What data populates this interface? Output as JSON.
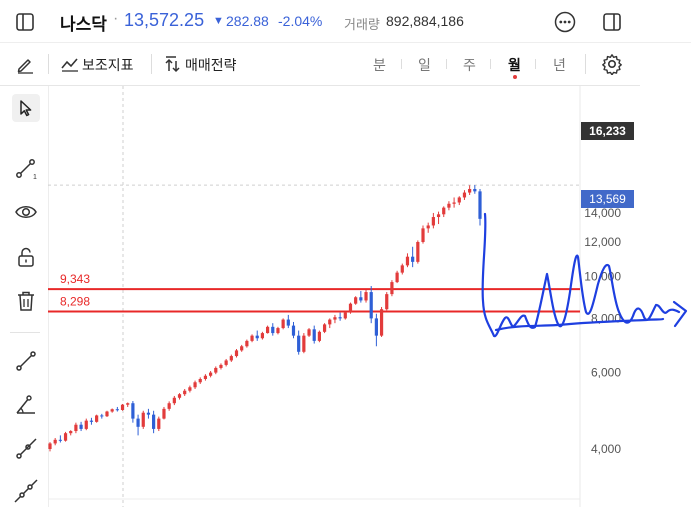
{
  "header": {
    "symbol": "나스닥",
    "dot": "·",
    "price": "13,572.25",
    "change_arrow": "▼",
    "change": "282.88",
    "change_pct": "-2.04%",
    "volume_label": "거래량",
    "volume": "892,884,186",
    "icons": [
      "sidebar-toggle-icon",
      "more-icon",
      "panel-icon"
    ]
  },
  "toolbar": {
    "indicators_label": "보조지표",
    "strategy_label": "매매전략",
    "periods": [
      "분",
      "일",
      "주",
      "월",
      "년"
    ],
    "active_period": "월",
    "icons": [
      "pen-icon",
      "indicator-icon",
      "strategy-icon",
      "settings-icon"
    ]
  },
  "left_tools": [
    "cursor-icon",
    "trendline-icon",
    "eye-icon",
    "unlock-icon",
    "trash-icon",
    "line-icon",
    "angle-icon",
    "ray-icon",
    "extended-line-icon"
  ],
  "colors": {
    "up": "#e23b3b",
    "down": "#2e5fd6",
    "accent": "#3a62d8",
    "hline": "#e82828",
    "annotation": "#1e3fe0",
    "price_tag": "#4169c9",
    "high_tag": "#333333"
  },
  "chart_data": {
    "type": "candlestick",
    "y_scale": "log",
    "ylim": [
      3000,
      22000
    ],
    "y_ticks": [
      "4,000",
      "6,000",
      "8,000",
      "10,000",
      "12,000",
      "14,000"
    ],
    "tags": {
      "high": "16,233",
      "current": "13,569"
    },
    "hlines": [
      {
        "label": "9,343",
        "value": 9343
      },
      {
        "label": "8,298",
        "value": 8298
      }
    ],
    "ohlc": [
      [
        4000,
        4150,
        3950,
        4120
      ],
      [
        4120,
        4240,
        4080,
        4200
      ],
      [
        4200,
        4300,
        4140,
        4180
      ],
      [
        4180,
        4380,
        4160,
        4350
      ],
      [
        4350,
        4420,
        4300,
        4400
      ],
      [
        4400,
        4600,
        4350,
        4550
      ],
      [
        4550,
        4620,
        4400,
        4450
      ],
      [
        4450,
        4700,
        4420,
        4650
      ],
      [
        4650,
        4720,
        4550,
        4620
      ],
      [
        4620,
        4800,
        4600,
        4780
      ],
      [
        4780,
        4820,
        4700,
        4760
      ],
      [
        4760,
        4900,
        4740,
        4880
      ],
      [
        4880,
        4960,
        4850,
        4940
      ],
      [
        4940,
        5000,
        4880,
        4920
      ],
      [
        4920,
        5080,
        4900,
        5060
      ],
      [
        5060,
        5120,
        5000,
        5100
      ],
      [
        5100,
        5160,
        4600,
        4700
      ],
      [
        4700,
        4800,
        4300,
        4500
      ],
      [
        4500,
        4900,
        4450,
        4850
      ],
      [
        4850,
        4950,
        4700,
        4800
      ],
      [
        4800,
        4900,
        4350,
        4450
      ],
      [
        4450,
        4750,
        4400,
        4700
      ],
      [
        4700,
        5000,
        4680,
        4950
      ],
      [
        4950,
        5150,
        4900,
        5100
      ],
      [
        5100,
        5300,
        5050,
        5250
      ],
      [
        5250,
        5380,
        5200,
        5350
      ],
      [
        5350,
        5500,
        5300,
        5450
      ],
      [
        5450,
        5600,
        5400,
        5550
      ],
      [
        5550,
        5750,
        5500,
        5700
      ],
      [
        5700,
        5850,
        5650,
        5800
      ],
      [
        5800,
        5950,
        5750,
        5900
      ],
      [
        5900,
        6050,
        5850,
        6000
      ],
      [
        6000,
        6200,
        5950,
        6150
      ],
      [
        6150,
        6300,
        6100,
        6250
      ],
      [
        6250,
        6450,
        6200,
        6400
      ],
      [
        6400,
        6600,
        6350,
        6550
      ],
      [
        6550,
        6800,
        6500,
        6750
      ],
      [
        6750,
        6950,
        6700,
        6900
      ],
      [
        6900,
        7150,
        6850,
        7100
      ],
      [
        7100,
        7350,
        7050,
        7300
      ],
      [
        7300,
        7500,
        7100,
        7200
      ],
      [
        7200,
        7450,
        7150,
        7400
      ],
      [
        7400,
        7700,
        7380,
        7650
      ],
      [
        7650,
        7800,
        7300,
        7400
      ],
      [
        7400,
        7650,
        7350,
        7600
      ],
      [
        7600,
        8000,
        7550,
        7950
      ],
      [
        7950,
        8150,
        7600,
        7700
      ],
      [
        7700,
        7850,
        7200,
        7300
      ],
      [
        7300,
        7500,
        6600,
        6700
      ],
      [
        6700,
        7400,
        6650,
        7300
      ],
      [
        7300,
        7600,
        7250,
        7550
      ],
      [
        7550,
        7700,
        7000,
        7100
      ],
      [
        7100,
        7500,
        7050,
        7450
      ],
      [
        7450,
        7800,
        7400,
        7750
      ],
      [
        7750,
        8000,
        7600,
        7950
      ],
      [
        7950,
        8150,
        7800,
        8050
      ],
      [
        8050,
        8250,
        7900,
        8000
      ],
      [
        8000,
        8300,
        7950,
        8250
      ],
      [
        8250,
        8700,
        8200,
        8650
      ],
      [
        8650,
        9000,
        8600,
        8950
      ],
      [
        8950,
        9250,
        8700,
        8800
      ],
      [
        8800,
        9300,
        8700,
        9200
      ],
      [
        9200,
        9500,
        7800,
        8000
      ],
      [
        8000,
        8200,
        6900,
        7300
      ],
      [
        7300,
        8500,
        7250,
        8400
      ],
      [
        8400,
        9200,
        8350,
        9100
      ],
      [
        9100,
        9800,
        9000,
        9700
      ],
      [
        9700,
        10300,
        9650,
        10200
      ],
      [
        10200,
        10700,
        10100,
        10600
      ],
      [
        10600,
        11300,
        10500,
        11100
      ],
      [
        11100,
        11700,
        10500,
        10800
      ],
      [
        10800,
        12100,
        10700,
        12000
      ],
      [
        12000,
        13100,
        11900,
        12900
      ],
      [
        12900,
        13300,
        12600,
        13100
      ],
      [
        13100,
        14000,
        12900,
        13700
      ],
      [
        13700,
        14100,
        13200,
        13900
      ],
      [
        13900,
        14500,
        13700,
        14400
      ],
      [
        14400,
        14900,
        14200,
        14700
      ],
      [
        14700,
        15200,
        14400,
        14800
      ],
      [
        14800,
        15300,
        14600,
        15200
      ],
      [
        15200,
        15800,
        15000,
        15600
      ],
      [
        15600,
        16212,
        15400,
        15900
      ],
      [
        15900,
        16233,
        15500,
        15700
      ],
      [
        15700,
        15900,
        13100,
        13569
      ]
    ]
  },
  "annotation": {
    "kind": "freehand-forecast"
  }
}
